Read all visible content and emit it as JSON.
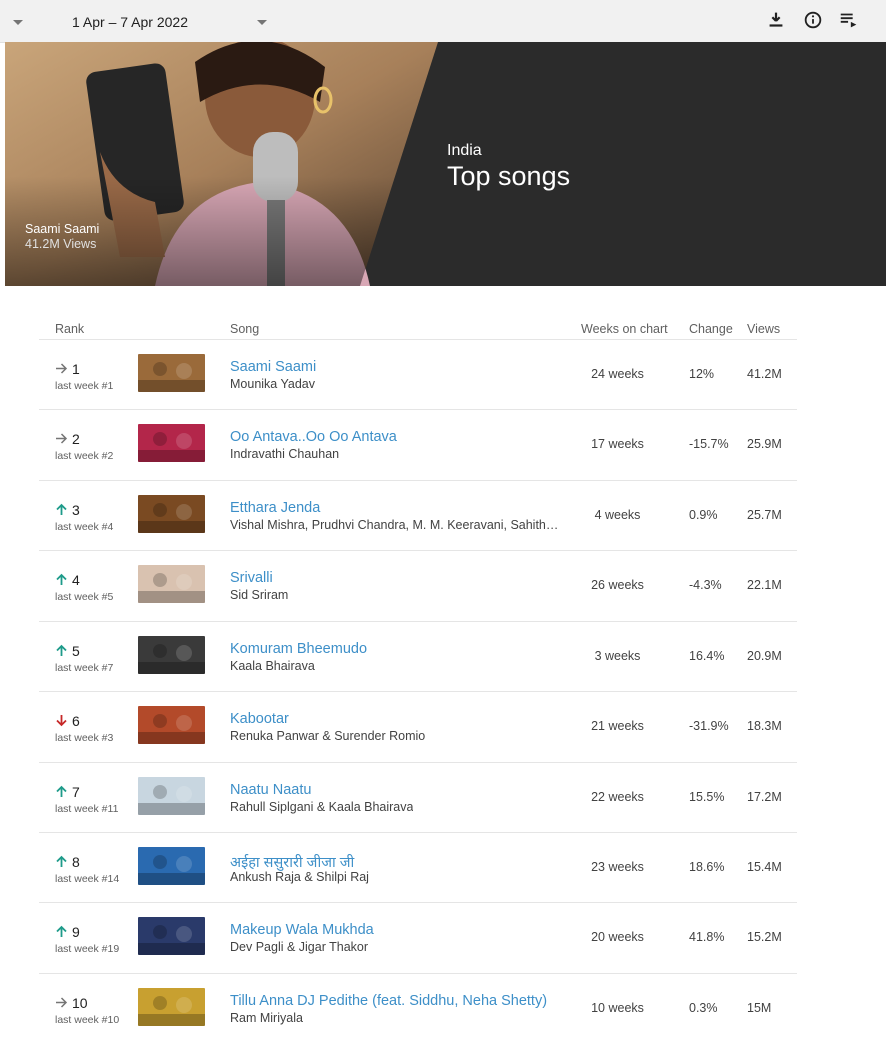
{
  "toolbar": {
    "date_range": "1 Apr – 7 Apr 2022",
    "icons": [
      "download-icon",
      "info-icon",
      "playlist-icon"
    ]
  },
  "hero": {
    "featured_title": "Saami Saami",
    "featured_views": "41.2M Views",
    "country": "India",
    "chart_title": "Top songs"
  },
  "table": {
    "headers": {
      "rank": "Rank",
      "song": "Song",
      "weeks": "Weeks on chart",
      "change": "Change",
      "views": "Views"
    },
    "rows": [
      {
        "rank": "1",
        "trend": "same",
        "last_week": "last week #1",
        "title": "Saami Saami",
        "artist": "Mounika Yadav",
        "weeks": "24 weeks",
        "change": "12%",
        "views": "41.2M",
        "thumb_color": "#9a6a3a"
      },
      {
        "rank": "2",
        "trend": "same",
        "last_week": "last week #2",
        "title": "Oo Antava..Oo Oo Antava",
        "artist": "Indravathi Chauhan",
        "weeks": "17 weeks",
        "change": "-15.7%",
        "views": "25.9M",
        "thumb_color": "#b3264a"
      },
      {
        "rank": "3",
        "trend": "up",
        "last_week": "last week #4",
        "title": "Etthara Jenda",
        "artist": "Vishal Mishra, Prudhvi Chandra, M. M. Keeravani, Sahithi Chaganti, Harika Narayan",
        "weeks": "4 weeks",
        "change": "0.9%",
        "views": "25.7M",
        "thumb_color": "#7a4a22"
      },
      {
        "rank": "4",
        "trend": "up",
        "last_week": "last week #5",
        "title": "Srivalli",
        "artist": "Sid Sriram",
        "weeks": "26 weeks",
        "change": "-4.3%",
        "views": "22.1M",
        "thumb_color": "#d9c2b0"
      },
      {
        "rank": "5",
        "trend": "up",
        "last_week": "last week #7",
        "title": "Komuram Bheemudo",
        "artist": "Kaala Bhairava",
        "weeks": "3 weeks",
        "change": "16.4%",
        "views": "20.9M",
        "thumb_color": "#3a3a3a"
      },
      {
        "rank": "6",
        "trend": "down",
        "last_week": "last week #3",
        "title": "Kabootar",
        "artist": "Renuka Panwar & Surender Romio",
        "weeks": "21 weeks",
        "change": "-31.9%",
        "views": "18.3M",
        "thumb_color": "#b34a2a"
      },
      {
        "rank": "7",
        "trend": "up",
        "last_week": "last week #11",
        "title": "Naatu Naatu",
        "artist": "Rahull Siplgani & Kaala Bhairava",
        "weeks": "22 weeks",
        "change": "15.5%",
        "views": "17.2M",
        "thumb_color": "#c8d6e0"
      },
      {
        "rank": "8",
        "trend": "up",
        "last_week": "last week #14",
        "title": "अईहा ससुरारी जीजा जी",
        "artist": "Ankush Raja & Shilpi Raj",
        "weeks": "23 weeks",
        "change": "18.6%",
        "views": "15.4M",
        "thumb_color": "#2a6ab0"
      },
      {
        "rank": "9",
        "trend": "up",
        "last_week": "last week #19",
        "title": "Makeup Wala Mukhda",
        "artist": "Dev Pagli & Jigar Thakor",
        "weeks": "20 weeks",
        "change": "41.8%",
        "views": "15.2M",
        "thumb_color": "#2a3a6a"
      },
      {
        "rank": "10",
        "trend": "same",
        "last_week": "last week #10",
        "title": "Tillu Anna DJ Pedithe (feat. Siddhu, Neha Shetty)",
        "artist": "Ram Miriyala",
        "weeks": "10 weeks",
        "change": "0.3%",
        "views": "15M",
        "thumb_color": "#c8a030"
      }
    ]
  },
  "colors": {
    "link": "#3d8fc8",
    "up": "#1e9b8a",
    "down": "#c62828",
    "same": "#757575"
  }
}
